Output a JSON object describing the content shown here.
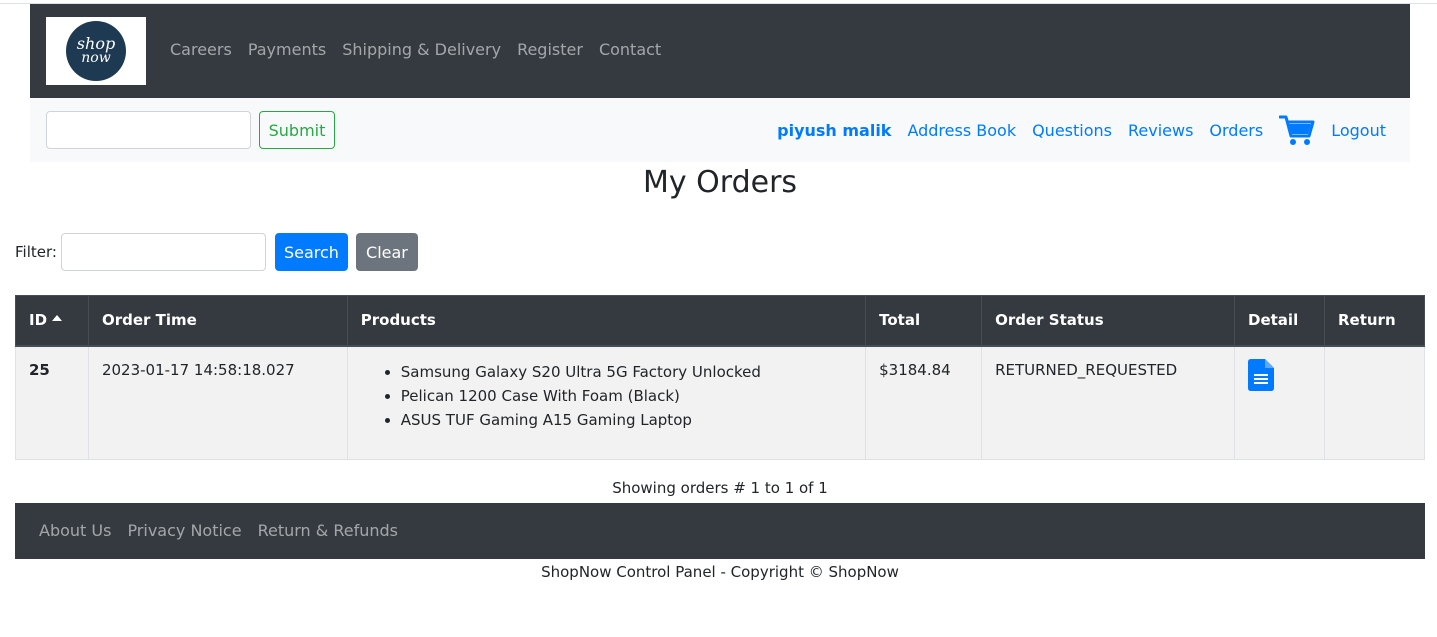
{
  "logo": {
    "line1": "shop",
    "line2": "now"
  },
  "nav": {
    "links": [
      "Careers",
      "Payments",
      "Shipping & Delivery",
      "Register",
      "Contact"
    ]
  },
  "subbar": {
    "search_value": "",
    "submit_label": "Submit",
    "user_name": "piyush malik",
    "links": [
      "Address Book",
      "Questions",
      "Reviews",
      "Orders"
    ],
    "logout_label": "Logout",
    "cart_icon": "shopping-cart-icon"
  },
  "page": {
    "title": "My Orders"
  },
  "filter": {
    "label": "Filter:",
    "value": "",
    "search_label": "Search",
    "clear_label": "Clear"
  },
  "table": {
    "headers": {
      "id": "ID",
      "order_time": "Order Time",
      "products": "Products",
      "total": "Total",
      "order_status": "Order Status",
      "detail": "Detail",
      "return": "Return"
    },
    "rows": [
      {
        "id": "25",
        "order_time": "2023-01-17 14:58:18.027",
        "products": [
          "Samsung Galaxy S20 Ultra 5G Factory Unlocked",
          "Pelican 1200 Case With Foam (Black)",
          "ASUS TUF Gaming A15 Gaming Laptop"
        ],
        "total": "$3184.84",
        "order_status": "RETURNED_REQUESTED",
        "detail_icon": "document-icon",
        "return": ""
      }
    ]
  },
  "showing_text": "Showing orders # 1 to 1 of 1",
  "footer": {
    "links": [
      "About Us",
      "Privacy Notice",
      "Return & Refunds"
    ],
    "copyright": "ShopNow Control Panel - Copyright © ShopNow"
  },
  "colors": {
    "navbar_bg": "#343a40",
    "primary": "#007bff",
    "success": "#28a745",
    "secondary": "#6c757d"
  }
}
